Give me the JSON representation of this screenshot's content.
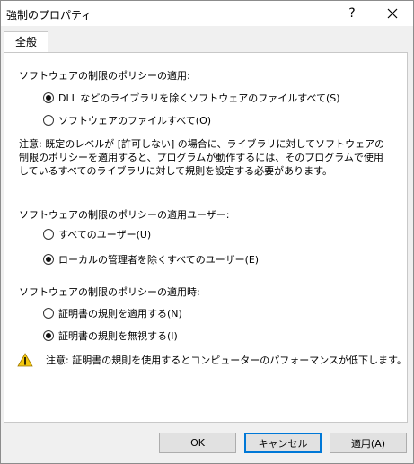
{
  "window": {
    "title": "強制のプロパティ",
    "help_label": "?"
  },
  "tabs": [
    {
      "label": "全般",
      "active": true
    }
  ],
  "section_apply": {
    "heading": "ソフトウェアの制限のポリシーの適用:",
    "options": [
      {
        "label": "DLL などのライブラリを除くソフトウェアのファイルすべて(S)",
        "checked": true
      },
      {
        "label": "ソフトウェアのファイルすべて(O)",
        "checked": false
      }
    ],
    "note": "注意: 既定のレベルが [許可しない] の場合に、ライブラリに対してソフトウェアの制限のポリシーを適用すると、プログラムが動作するには、そのプログラムで使用しているすべてのライブラリに対して規則を設定する必要があります。"
  },
  "section_users": {
    "heading": "ソフトウェアの制限のポリシーの適用ユーザー:",
    "options": [
      {
        "label": "すべてのユーザー(U)",
        "checked": false
      },
      {
        "label": "ローカルの管理者を除くすべてのユーザー(E)",
        "checked": true
      }
    ]
  },
  "section_when": {
    "heading": "ソフトウェアの制限のポリシーの適用時:",
    "options": [
      {
        "label": "証明書の規則を適用する(N)",
        "checked": false
      },
      {
        "label": "証明書の規則を無視する(I)",
        "checked": true
      }
    ]
  },
  "warning": {
    "text": "注意: 証明書の規則を使用するとコンピューターのパフォーマンスが低下します。"
  },
  "buttons": {
    "ok": "OK",
    "cancel": "キャンセル",
    "apply": "適用(A)"
  },
  "colors": {
    "accent": "#0078d7",
    "warning_fill": "#f2c811"
  }
}
